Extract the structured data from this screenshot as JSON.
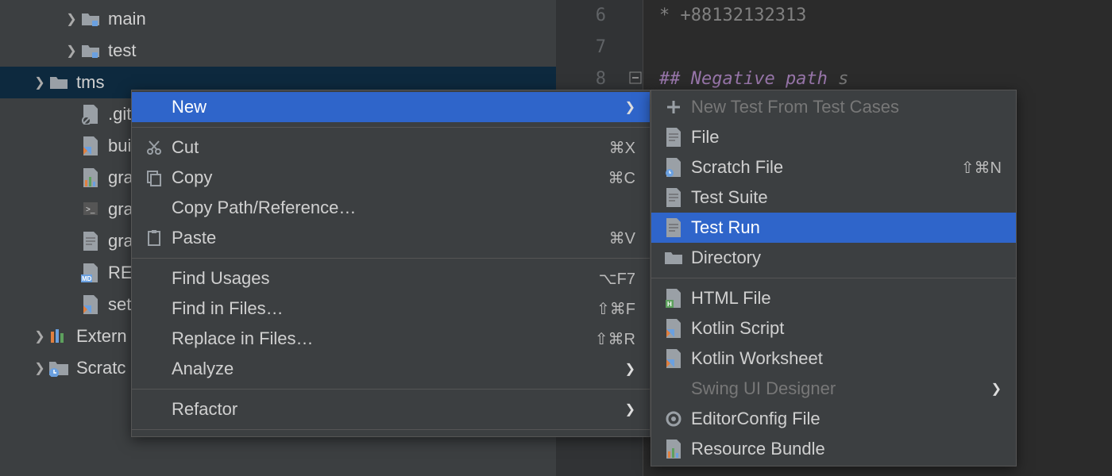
{
  "tree": {
    "items": [
      {
        "label": "main",
        "indent": 80,
        "chevron": true,
        "icon": "folder-source"
      },
      {
        "label": "test",
        "indent": 80,
        "chevron": true,
        "icon": "folder-source"
      },
      {
        "label": "tms",
        "indent": 40,
        "chevron": true,
        "icon": "folder",
        "selected": true
      },
      {
        "label": ".git",
        "indent": 80,
        "chevron": false,
        "icon": "file-ignored"
      },
      {
        "label": "bui",
        "indent": 80,
        "chevron": false,
        "icon": "kotlin-file"
      },
      {
        "label": "gra",
        "indent": 80,
        "chevron": false,
        "icon": "bars-file"
      },
      {
        "label": "gra",
        "indent": 80,
        "chevron": false,
        "icon": "cmd-file"
      },
      {
        "label": "gra",
        "indent": 80,
        "chevron": false,
        "icon": "text-file"
      },
      {
        "label": "RE",
        "indent": 80,
        "chevron": false,
        "icon": "md-file"
      },
      {
        "label": "set",
        "indent": 80,
        "chevron": false,
        "icon": "kotlin-file"
      },
      {
        "label": "Extern",
        "indent": 40,
        "chevron": true,
        "icon": "ext-libs"
      },
      {
        "label": "Scratc",
        "indent": 40,
        "chevron": true,
        "icon": "scratch-folder"
      }
    ]
  },
  "editor": {
    "gutter": [
      "6",
      "7",
      "8"
    ],
    "line6": "* +88132132313",
    "line8": "## Negative path"
  },
  "context_menu": {
    "items": [
      {
        "label": "New",
        "icon": "",
        "shortcut": "",
        "arrow": true,
        "highlight": true,
        "sep_after": true
      },
      {
        "label": "Cut",
        "icon": "cut",
        "shortcut": "⌘X"
      },
      {
        "label": "Copy",
        "icon": "copy",
        "shortcut": "⌘C"
      },
      {
        "label": "Copy Path/Reference…",
        "icon": ""
      },
      {
        "label": "Paste",
        "icon": "paste",
        "shortcut": "⌘V",
        "sep_after": true
      },
      {
        "label": "Find Usages",
        "icon": "",
        "shortcut": "⌥F7"
      },
      {
        "label": "Find in Files…",
        "icon": "",
        "shortcut": "⇧⌘F"
      },
      {
        "label": "Replace in Files…",
        "icon": "",
        "shortcut": "⇧⌘R"
      },
      {
        "label": "Analyze",
        "icon": "",
        "arrow": true,
        "sep_after": true
      },
      {
        "label": "Refactor",
        "icon": "",
        "arrow": true,
        "sep_after": true
      }
    ]
  },
  "submenu": {
    "items": [
      {
        "label": "New Test From Test Cases",
        "icon": "new-test",
        "disabled": true
      },
      {
        "label": "File",
        "icon": "text-file"
      },
      {
        "label": "Scratch File",
        "icon": "scratch-file",
        "shortcut": "⇧⌘N"
      },
      {
        "label": "Test Suite",
        "icon": "text-file"
      },
      {
        "label": "Test Run",
        "icon": "text-file",
        "highlight": true
      },
      {
        "label": "Directory",
        "icon": "folder",
        "sep_after": true
      },
      {
        "label": "HTML File",
        "icon": "html-file"
      },
      {
        "label": "Kotlin Script",
        "icon": "kotlin-file"
      },
      {
        "label": "Kotlin Worksheet",
        "icon": "kotlin-file"
      },
      {
        "label": "Swing UI Designer",
        "icon": "",
        "arrow": true,
        "disabled": true
      },
      {
        "label": "EditorConfig File",
        "icon": "gear-file"
      },
      {
        "label": "Resource Bundle",
        "icon": "bars-file"
      }
    ]
  }
}
